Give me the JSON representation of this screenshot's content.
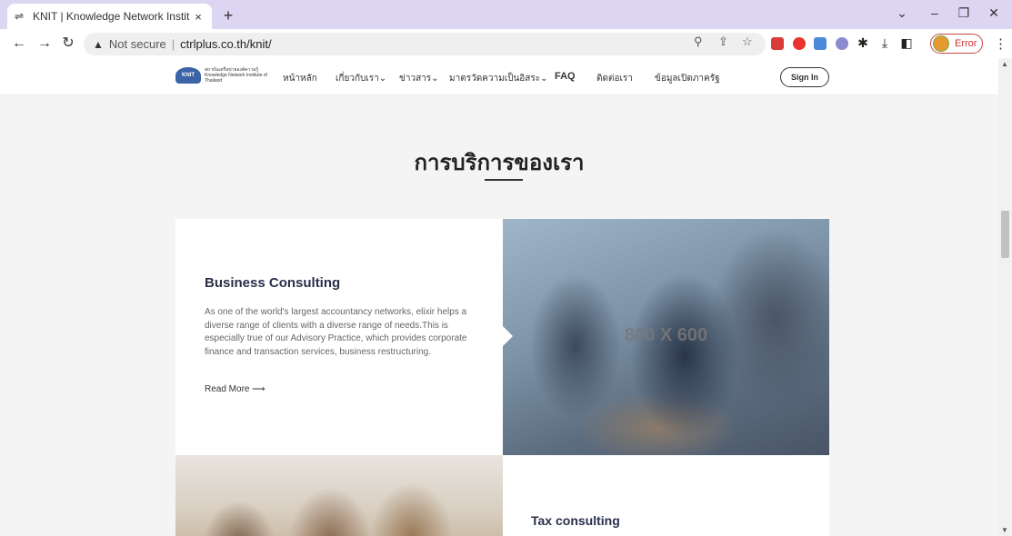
{
  "browser": {
    "tab_title": "KNIT | Knowledge Network Instit",
    "tab_close": "×",
    "new_tab": "+",
    "url_warning": "Not secure",
    "url": "ctrlplus.co.th/knit/",
    "profile_status": "Error"
  },
  "site": {
    "logo_text": "สถาบันเครือข่ายองค์ความรู้ Knowledge Network Institute of Thailand",
    "logo_mark": "KNIT",
    "nav": [
      {
        "label": "หน้าหลัก"
      },
      {
        "label": "เกี่ยวกับเรา⌄"
      },
      {
        "label": "ข่าวสาร⌄"
      },
      {
        "label": "มาตรวัดความเป็นอิสระ⌄"
      },
      {
        "label": "FAQ"
      },
      {
        "label": "ติดต่อเรา"
      },
      {
        "label": "ข้อมูลเปิดภาครัฐ"
      }
    ],
    "signin": "Sign In"
  },
  "section": {
    "title": "การบริการของเรา",
    "cards": [
      {
        "heading": "Business Consulting",
        "body": "As one of the world's largest accountancy networks, elixir helps a diverse range of clients with a diverse range of needs.This is especially true of our Advisory Practice, which provides corporate finance and transaction services, business restructuring.",
        "read_more": "Read More ⟶",
        "image_label": "800 X 600"
      },
      {
        "heading": "Tax consulting"
      }
    ]
  }
}
